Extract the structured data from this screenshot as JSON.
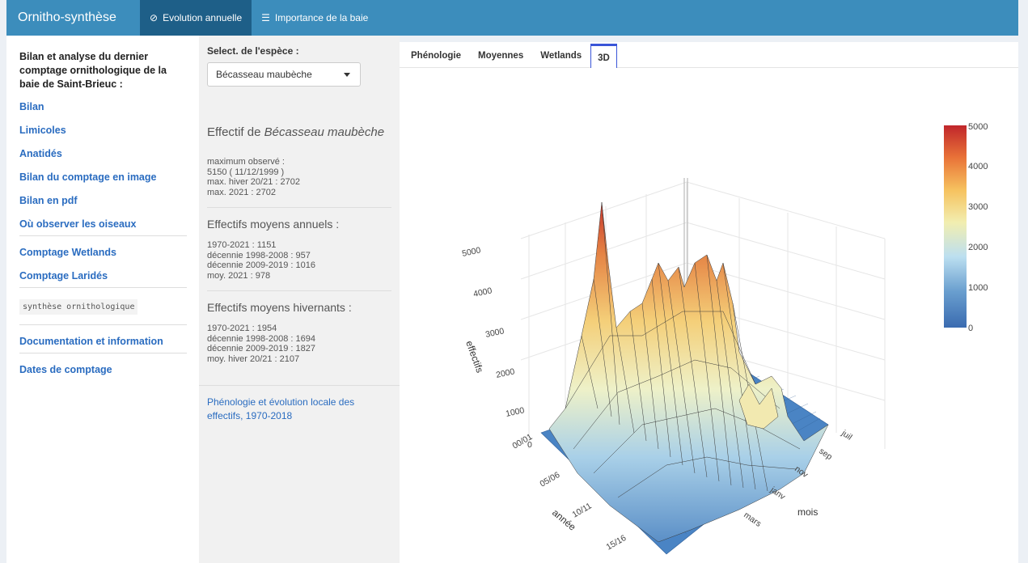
{
  "navbar": {
    "brand": "Ornitho-synthèse",
    "items": [
      {
        "label": "Evolution annuelle",
        "icon": "compass-icon",
        "active": true
      },
      {
        "label": "Importance de la baie",
        "icon": "list-icon",
        "active": false
      }
    ]
  },
  "sidebar": {
    "heading": "Bilan et analyse du dernier comptage ornithologique de la baie de Saint-Brieuc :",
    "links_a": [
      "Bilan",
      "Limicoles",
      "Anatidés",
      "Bilan du comptage en image",
      "Bilan en pdf",
      "Où observer les oiseaux"
    ],
    "links_b": [
      "Comptage Wetlands",
      "Comptage Laridés"
    ],
    "code": "synthèse ornithologique",
    "links_c": [
      "Documentation et information",
      "Dates de comptage"
    ]
  },
  "panel": {
    "select_label": "Select. de l'espèce :",
    "select_value": "Bécasseau maubèche",
    "effectif_prefix": "Effectif de ",
    "effectif_species": "Bécasseau maubèche",
    "max_lines": [
      "maximum observé :",
      "5150 ( 11/12/1999 )",
      "max. hiver 20/21 : 2702",
      "max. 2021 : 2702"
    ],
    "annual_title": "Effectifs moyens annuels :",
    "annual_lines": [
      "1970-2021 : 1151",
      "décennie 1998-2008 : 957",
      "décennie 2009-2019 : 1016",
      "moy. 2021 : 978"
    ],
    "winter_title": "Effectifs moyens hivernants :",
    "winter_lines": [
      "1970-2021 : 1954",
      "décennie 1998-2008 : 1694",
      "décennie 2009-2019 : 1827",
      "moy. hiver 20/21 : 2107"
    ],
    "link": "Phénologie et évolution locale des effectifs, 1970-2018"
  },
  "tabs": [
    "Phénologie",
    "Moyennes",
    "Wetlands",
    "3D"
  ],
  "active_tab": "3D",
  "chart_data": {
    "type": "surface",
    "zlabel": "effectifs",
    "xlabel": "année",
    "ylabel": "mois",
    "z_ticks": [
      "0",
      "1000",
      "2000",
      "3000",
      "4000",
      "5000"
    ],
    "x_ticks": [
      "00/01",
      "05/06",
      "10/11",
      "15/16"
    ],
    "y_ticks": [
      "juil",
      "sep",
      "nov",
      "janv",
      "mars"
    ],
    "zlim": [
      0,
      5000
    ],
    "colorbar_ticks": [
      "5000",
      "4000",
      "3000",
      "2000",
      "1000",
      "0"
    ],
    "colorscale": [
      "#3a6bb0",
      "#6a9fcf",
      "#bcdff0",
      "#f2eeb0",
      "#f6c25f",
      "#e97338",
      "#c0262b"
    ],
    "max_value": 5150
  }
}
